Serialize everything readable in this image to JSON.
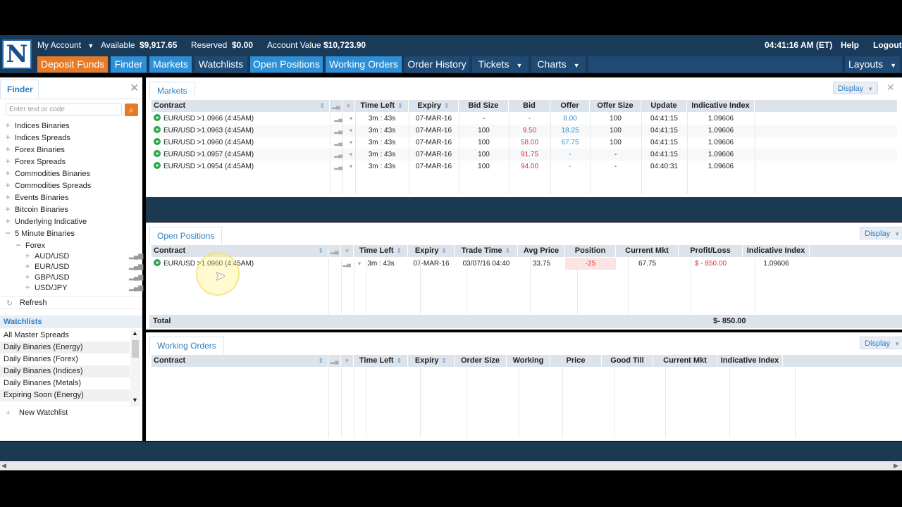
{
  "header": {
    "logo_letter": "N",
    "my_account": "My Account",
    "available_label": "Available",
    "available_value": "$9,917.65",
    "reserved_label": "Reserved",
    "reserved_value": "$0.00",
    "account_value_label": "Account Value",
    "account_value": "$10,723.90",
    "clock": "04:41:16 AM (ET)",
    "help": "Help",
    "logout": "Logout"
  },
  "nav": {
    "deposit": "Deposit Funds",
    "finder": "Finder",
    "markets": "Markets",
    "watchlists": "Watchlists",
    "open_positions": "Open Positions",
    "working_orders": "Working Orders",
    "order_history": "Order History",
    "tickets": "Tickets",
    "charts": "Charts",
    "layouts": "Layouts"
  },
  "finder": {
    "title": "Finder",
    "placeholder": "Enter text or code",
    "categories": [
      "Indices Binaries",
      "Indices Spreads",
      "Forex Binaries",
      "Forex Spreads",
      "Commodities Binaries",
      "Commodities Spreads",
      "Events Binaries",
      "Bitcoin Binaries",
      "Underlying Indicative",
      "5 Minute Binaries"
    ],
    "subcategory": "Forex",
    "pairs": [
      "AUD/USD",
      "EUR/USD",
      "GBP/USD",
      "USD/JPY"
    ],
    "refresh": "Refresh"
  },
  "watchlists": {
    "title": "Watchlists",
    "items": [
      "All Master Spreads",
      "Daily Binaries (Energy)",
      "Daily Binaries (Forex)",
      "Daily Binaries (Indices)",
      "Daily Binaries (Metals)",
      "Expiring Soon (Energy)"
    ],
    "new_watchlist": "New Watchlist"
  },
  "markets": {
    "title": "Markets",
    "display": "Display",
    "columns": [
      "Contract",
      "Time Left",
      "Expiry",
      "Bid Size",
      "Bid",
      "Offer",
      "Offer Size",
      "Update",
      "Indicative Index"
    ],
    "rows": [
      {
        "contract": "EUR/USD >1.0966 (4:45AM)",
        "time_left": "3m : 43s",
        "expiry": "07-MAR-16",
        "bid_size": "-",
        "bid": "-",
        "offer": "8.00",
        "offer_size": "100",
        "update": "04:41:15",
        "index": "1.09606"
      },
      {
        "contract": "EUR/USD >1.0963 (4:45AM)",
        "time_left": "3m : 43s",
        "expiry": "07-MAR-16",
        "bid_size": "100",
        "bid": "9.50",
        "offer": "18.25",
        "offer_size": "100",
        "update": "04:41:15",
        "index": "1.09606"
      },
      {
        "contract": "EUR/USD >1.0960 (4:45AM)",
        "time_left": "3m : 43s",
        "expiry": "07-MAR-16",
        "bid_size": "100",
        "bid": "58.00",
        "offer": "67.75",
        "offer_size": "100",
        "update": "04:41:15",
        "index": "1.09606"
      },
      {
        "contract": "EUR/USD >1.0957 (4:45AM)",
        "time_left": "3m : 43s",
        "expiry": "07-MAR-16",
        "bid_size": "100",
        "bid": "91.75",
        "offer": "-",
        "offer_size": "-",
        "update": "04:41:15",
        "index": "1.09606"
      },
      {
        "contract": "EUR/USD >1.0954 (4:45AM)",
        "time_left": "3m : 43s",
        "expiry": "07-MAR-16",
        "bid_size": "100",
        "bid": "94.00",
        "offer": "-",
        "offer_size": "-",
        "update": "04:40:31",
        "index": "1.09606"
      }
    ]
  },
  "open_positions": {
    "title": "Open Positions",
    "display": "Display",
    "columns": [
      "Contract",
      "Time Left",
      "Expiry",
      "Trade Time",
      "Avg Price",
      "Position",
      "Current Mkt",
      "Profit/Loss",
      "Indicative Index"
    ],
    "rows": [
      {
        "contract": "EUR/USD >1.0960 (4:45AM)",
        "time_left": "3m : 43s",
        "expiry": "07-MAR-16",
        "trade_time": "03/07/16 04:40",
        "avg_price": "33.75",
        "position": "-25",
        "current_mkt": "67.75",
        "pnl": "$ - 850.00",
        "index": "1.09606"
      }
    ],
    "total_label": "Total",
    "total_value": "$- 850.00"
  },
  "working_orders": {
    "title": "Working Orders",
    "display": "Display",
    "columns": [
      "Contract",
      "Time Left",
      "Expiry",
      "Order Size",
      "Working",
      "Price",
      "Good Till",
      "Current Mkt",
      "Indicative Index"
    ]
  },
  "colors": {
    "header_bg": "#1a3a5a",
    "active_tab": "#2d8fd6",
    "deposit": "#e87a26",
    "negative": "#dd3333",
    "positive": "#2aa84a"
  }
}
